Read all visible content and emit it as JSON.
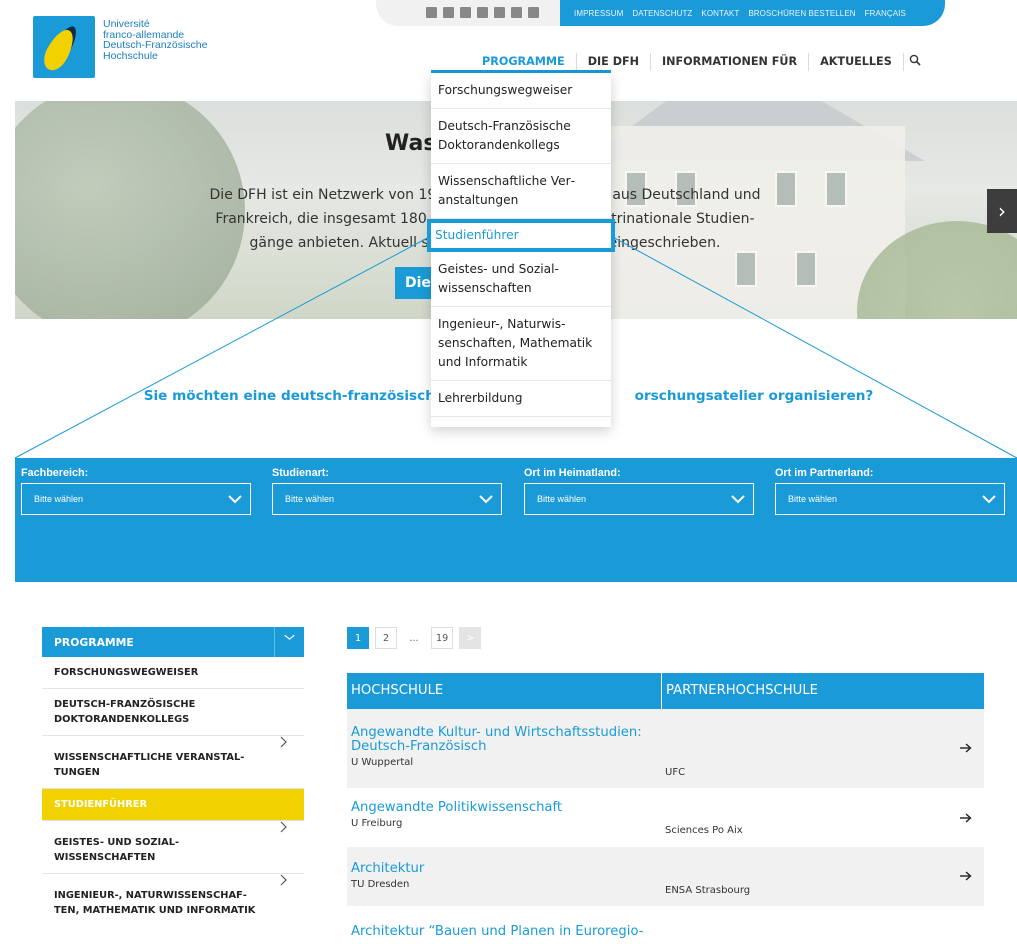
{
  "logo": {
    "lines": [
      "Université",
      "franco-allemande",
      "Deutsch-Französische",
      "Hochschule"
    ]
  },
  "topbar": {
    "social_icons": [
      "facebook-icon",
      "twitter-icon",
      "xing-icon",
      "instagram-icon",
      "youtube-icon",
      "linkedin-icon",
      "email-icon"
    ],
    "links": [
      "IMPRESSUM",
      "DATENSCHUTZ",
      "KONTAKT",
      "BROSCHÜREN BESTELLEN",
      "FRANÇAIS"
    ]
  },
  "nav": {
    "items": [
      "PROGRAMME",
      "DIE DFH",
      "INFORMATIONEN FÜR",
      "AKTUELLES"
    ],
    "search_icon": "search-icon"
  },
  "hero": {
    "title": "Was",
    "text": "Die DFH ist ein Netzwerk von 19… aus Deutschland und Frankreich, die insgesamt 180 i… trinationale Studien­gänge anbieten. Aktuell si… eingeschrieben.",
    "line1_left": "Die DFH ist ein Netzwerk von 19",
    "line1_right": "aus Deutschland und",
    "line2_left": "Frankreich, die insgesamt 180 i",
    "line2_right": "trinationale Studien-",
    "line3_left": "gänge anbieten. Aktuell si",
    "line3_right": "eingeschrieben.",
    "button": "Die",
    "arrow": "›"
  },
  "tagline": {
    "left": "Sie möchten eine deutsch-französische S",
    "right": "orschungsatelier organisieren?"
  },
  "dropdown": {
    "items": [
      "Forschungswegweiser",
      "Deutsch-Französische Doktorandenkollegs",
      "Wissenschaftliche Ver­anstaltungen",
      "Studienführer",
      "Geistes- und Sozial­wissenschaften",
      "Ingenieur-, Naturwis­senschaften, Mathema­tik und Informatik",
      "Lehrerbildung"
    ],
    "highlighted_index": 3
  },
  "filters": [
    {
      "label": "Fachbereich:",
      "value": "Bitte wählen"
    },
    {
      "label": "Studienart:",
      "value": "Bitte wählen"
    },
    {
      "label": "Ort im Heimatland:",
      "value": "Bitte wählen"
    },
    {
      "label": "Ort im Partnerland:",
      "value": "Bitte wählen"
    }
  ],
  "sidebar": {
    "title": "PROGRAMME",
    "items": [
      {
        "label": "FORSCHUNGSWEGWEISER",
        "arrow": false,
        "active": false
      },
      {
        "label": "DEUTSCH-FRANZÖSISCHE DOKTORANDEN­KOLLEGS",
        "arrow": false,
        "active": false
      },
      {
        "label": "WISSENSCHAFTLICHE VERANSTAL­TUNGEN",
        "arrow": true,
        "active": false
      },
      {
        "label": "STUDIENFÜHRER",
        "arrow": false,
        "active": true
      },
      {
        "label": "GEISTES- UND SOZIAL­WISSENSCHAFTEN",
        "arrow": true,
        "active": false
      },
      {
        "label": "INGENIEUR-, NATURWISSENSCHAF­TEN, MATHEMATIK UND INFORMA­TIK",
        "arrow": true,
        "active": false
      }
    ]
  },
  "pagination": {
    "pages": [
      "1",
      "2",
      "...",
      "19"
    ],
    "current": "1",
    "next": ">"
  },
  "table": {
    "headers": [
      "HOCHSCHULE",
      "PARTNERHOCHSCHULE"
    ],
    "rows": [
      {
        "course": "Angewandte Kultur- und Wirtschaftsstudien: Deutsch-Französisch",
        "uni": "U Wuppertal",
        "partner": "UFC"
      },
      {
        "course": "Angewandte Politikwissenschaft",
        "uni": "U Freiburg",
        "partner": "Sciences Po Aix"
      },
      {
        "course": "Architektur",
        "uni": "TU Dresden",
        "partner": "ENSA Strasbourg"
      },
      {
        "course": "Architektur “Bauen und Planen in Euroregio-",
        "uni": "",
        "partner": ""
      }
    ]
  },
  "colors": {
    "accent_blue": "#1a9bd7",
    "highlight_yellow": "#f2d100"
  }
}
